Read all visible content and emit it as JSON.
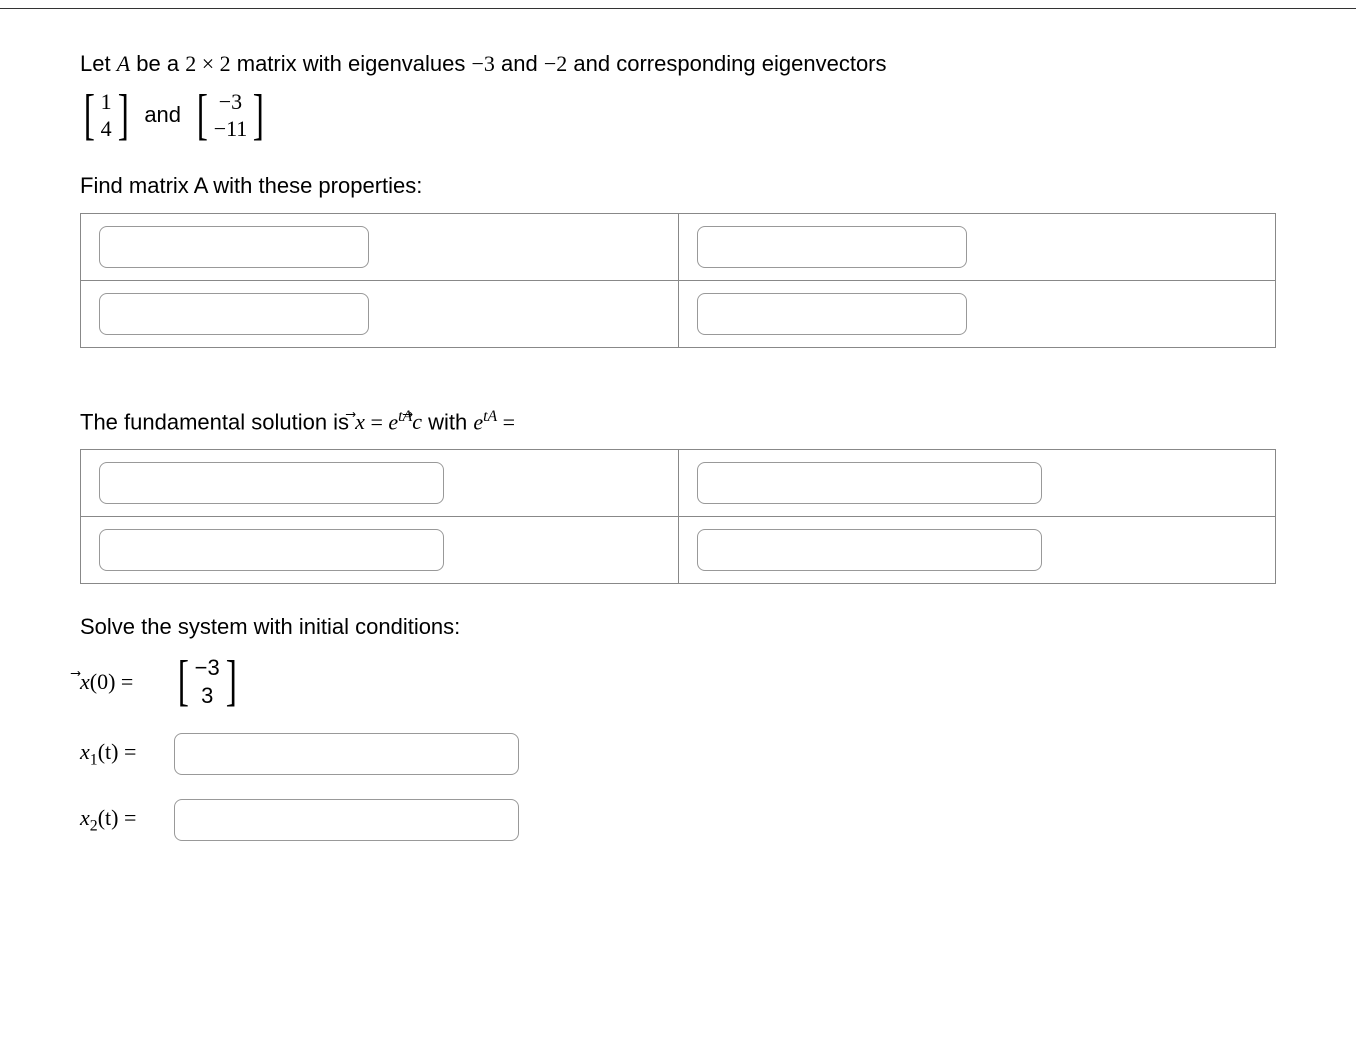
{
  "problem": {
    "stem_pre": "Let ",
    "A": "A",
    "stem_mid1": " be a ",
    "dim": "2 × 2",
    "stem_mid2": " matrix with eigenvalues ",
    "lam1": "−3",
    "and1": " and ",
    "lam2": "−2",
    "stem_mid3": " and corresponding eigenvectors",
    "v1_top": "1",
    "v1_bot": "4",
    "and2": "and",
    "v2_top": "−3",
    "v2_bot": "−11"
  },
  "sections": {
    "findA": "Find matrix A with these properties:",
    "fundamental_pre": "The fundamental solution is ",
    "fund_eq_lhs": "x",
    "fund_eq_eq": " = ",
    "fund_eq_e": "e",
    "fund_exp1": "tA",
    "fund_c": "c",
    "fund_with": " with ",
    "fund_e2": "e",
    "fund_exp2": "tA",
    "fund_eq2": " =",
    "solve_label": "Solve the system with initial conditions:",
    "ic_lhs": "x",
    "ic_arg": "(0)",
    "ic_eq": " = ",
    "ic_top": "−3",
    "ic_bot": "3",
    "x1_label_x": "x",
    "x1_label_sub": "1",
    "x1_label_t": "(t)",
    "x1_eq": " = ",
    "x2_label_x": "x",
    "x2_label_sub": "2",
    "x2_label_t": "(t)",
    "x2_eq": " = "
  },
  "inputs": {
    "A11": "",
    "A12": "",
    "A21": "",
    "A22": "",
    "E11": "",
    "E12": "",
    "E21": "",
    "E22": "",
    "x1": "",
    "x2": ""
  }
}
